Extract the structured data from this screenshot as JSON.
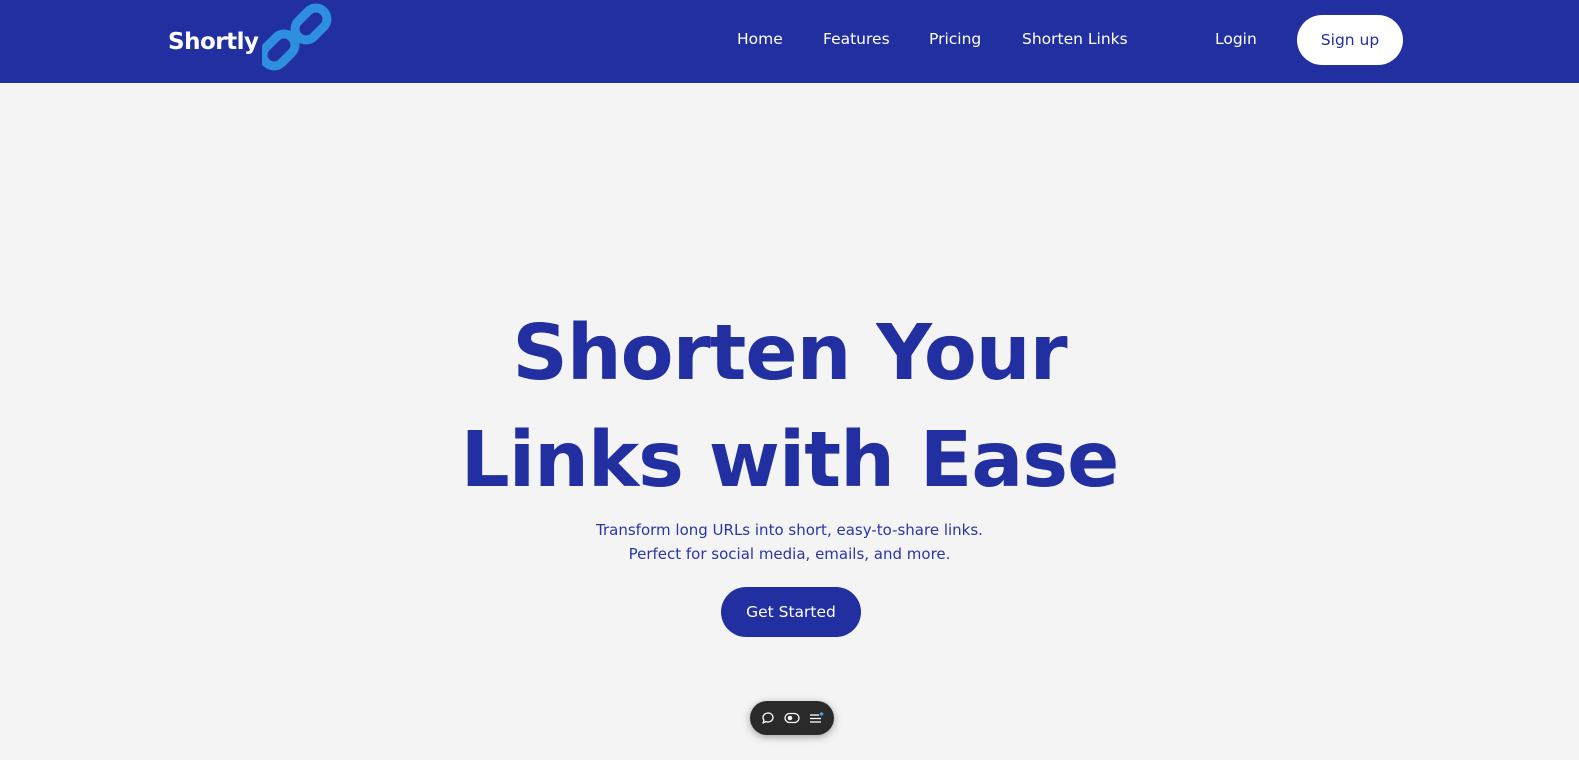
{
  "header": {
    "brand": "Shortly",
    "brand_color": "#212fa0",
    "logo_icon": "chain-link-icon",
    "logo_color": "#2e8ee0",
    "nav": [
      {
        "label": "Home"
      },
      {
        "label": "Features"
      },
      {
        "label": "Pricing"
      },
      {
        "label": "Shorten Links"
      }
    ],
    "login_label": "Login",
    "signup_label": "Sign up"
  },
  "hero": {
    "title_line1": "Shorten Your",
    "title_line2": "Links with Ease",
    "subtitle_line1": "Transform long URLs into short, easy-to-share links.",
    "subtitle_line2": "Perfect for social media, emails, and more.",
    "cta_label": "Get Started",
    "accent_color": "#212fa0",
    "background_color": "#f4f4f5"
  },
  "floating_toolbar": {
    "items": [
      {
        "icon": "comment-icon"
      },
      {
        "icon": "toggle-visibility-icon"
      },
      {
        "icon": "menu-icon"
      }
    ]
  }
}
